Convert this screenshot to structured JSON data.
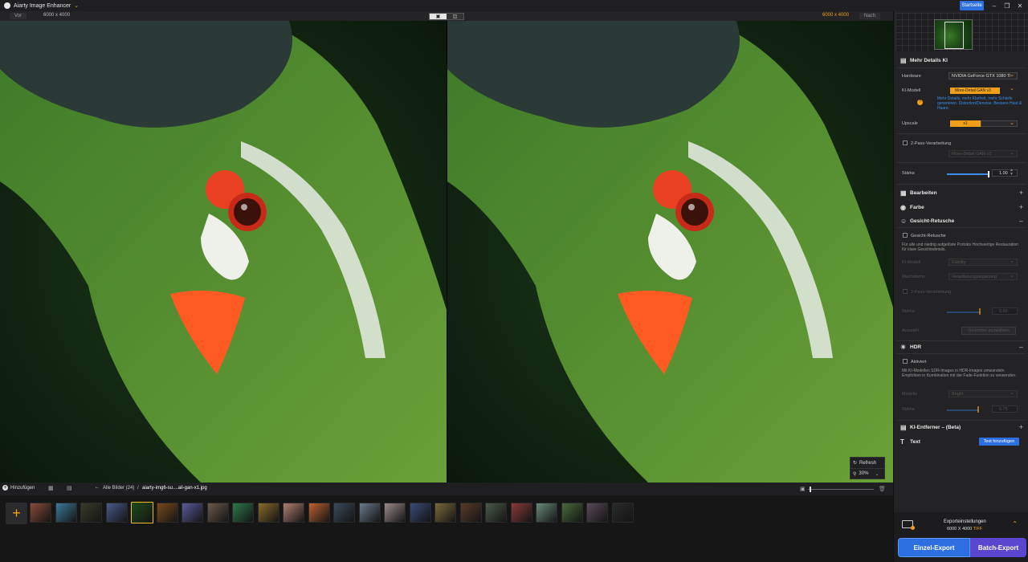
{
  "titlebar": {
    "app_title": "Aiarty Image Enhancer",
    "start_label": "Startseite"
  },
  "viewbar": {
    "before_label": "Vor",
    "after_label": "Nach",
    "res_before": "6000 x 4000",
    "res_after": "6000 x 4000"
  },
  "zoom": {
    "refresh_label": "Refresh",
    "zoom_value": "30%"
  },
  "bottombar": {
    "add_label": "Hinzufügen",
    "all_images": "Alle Bilder (24)",
    "separator": "/",
    "filename": "aiarty-img6-su....ail-gan-x1.jpg"
  },
  "filmstrip": {
    "count": 24,
    "selected_index": 4
  },
  "panel": {
    "mehr_details": {
      "title": "Mehr Details KI",
      "hardware_label": "Hardware",
      "hardware_value": "NVIDIA GeForce GTX 1080 Ti",
      "model_label": "KI-Modell",
      "model_value": "More-Detail GAN v3",
      "model_desc": "Mehr Details, mehr Klarheit, mehr Schärfe generieren. Distortion/Denoise. Bessere Haut & Haare.",
      "upscale_label": "Upscale",
      "upscale_value": "x1",
      "two_pass_label": "2-Pass-Verarbeitung",
      "two_pass_value": "More-Detail GAN v3",
      "strength_label": "Stärke",
      "strength_value": "1.00",
      "strength_level": 1.0
    },
    "bearbeiten": {
      "title": "Bearbeiten"
    },
    "farbe": {
      "title": "Farbe"
    },
    "gesicht": {
      "title": "Gesicht-Retusche",
      "checkbox_label": "Gesicht-Retusche",
      "desc": "Für alle und niedrig aufgelöste Porträts Hochwertige Restauration für klare Gesichtsdetails.",
      "model_label": "KI-Modell",
      "model_value": "Fidelity",
      "mode_label": "Wachstums",
      "mode_value": "Verwitterungslegierung",
      "two_pass_label": "2-Pass-Verarbeitung",
      "strength_label": "Stärke",
      "strength_value": "0.80",
      "strength_level": 0.8,
      "select_label": "Auswahl",
      "select_button": "Gesichter auswählen"
    },
    "hdr": {
      "title": "HDR",
      "checkbox_label": "Aktiviert",
      "desc": "Mit KI-Modellen SDR-Images in HDR-Images umwandeln. Empfohlen in Kombination mit der Fade-Funktion zu verwenden.",
      "mode_label": "Modelle",
      "mode_value": "Bright",
      "strength_label": "Stärke",
      "strength_value": "0.75",
      "strength_level": 0.75
    },
    "entferner": {
      "title": "KI-Entferner – (Beta)"
    },
    "text": {
      "title": "Text",
      "button": "Text hinzufügen"
    },
    "export": {
      "title": "Exporteinstellungen",
      "res": "6000 X 4000",
      "format": "TIFF",
      "single_label": "Einzel-Export",
      "batch_label": "Batch-Export"
    }
  },
  "colors": {
    "accent": "#f0a018",
    "brand_blue": "#2d6fe0",
    "batch_purple": "#5a47d0"
  },
  "icons": [
    "app-logo-icon",
    "chevron-down-icon",
    "minimize-icon",
    "maximize-icon",
    "close-icon",
    "refresh-icon",
    "zoom-icon",
    "plus-icon",
    "grid-icon",
    "compare-icon",
    "image-icon",
    "trash-icon",
    "details-icon",
    "edit-icon",
    "color-icon",
    "face-icon",
    "hdr-icon",
    "eraser-icon",
    "text-icon",
    "export-icon",
    "chevron-up-icon"
  ]
}
